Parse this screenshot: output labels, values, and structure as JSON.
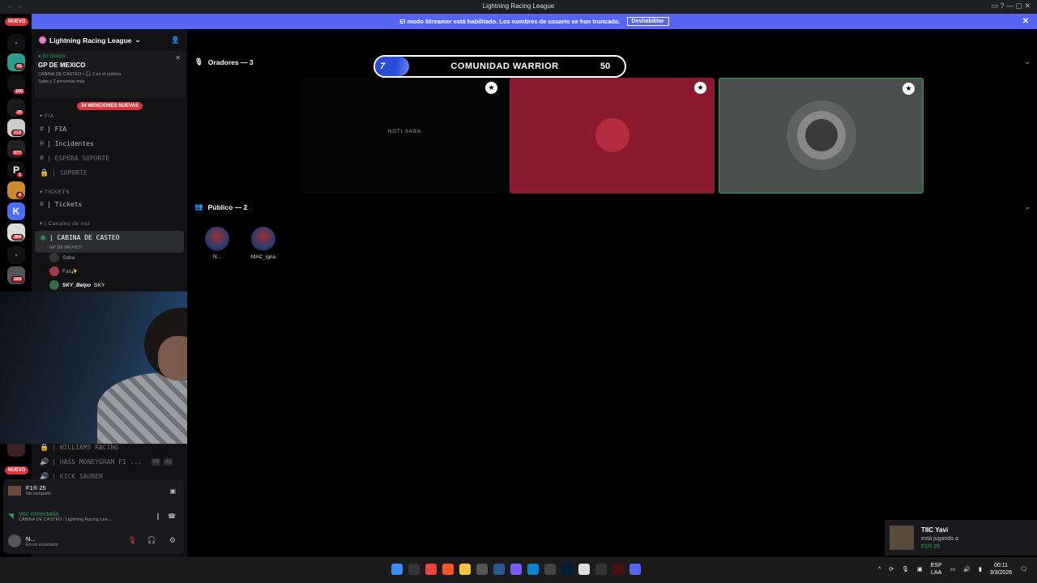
{
  "window": {
    "title": "Lightning Racing League",
    "nav": "←  →",
    "controls": "▭  ?  —  ▢  ✕"
  },
  "streamer_bar": {
    "message": "El modo Streamer está habilitado. Los nombres de usuario se han truncado.",
    "button": "Deshabilitar",
    "close": "✕"
  },
  "rail": {
    "nuevo_top": "NUEVO",
    "nuevo_bottom": "NUEVO",
    "badges": [
      "41",
      "160",
      "25",
      "113",
      "577",
      "1",
      "4",
      "384",
      "164"
    ]
  },
  "sidebar": {
    "guild_name": "Lightning Racing League",
    "guild_chevron": "⌄",
    "live": {
      "status": "En Directo",
      "event": "GP DE MEXICO",
      "info": "CABINA DE CASTEO • 🎧 2 en el público",
      "people": "Saba y 2 personas más",
      "close": "✕"
    },
    "mentions": "34 MENCIONES NUEVAS",
    "cat_fia": "FIA",
    "ch_fia": "| FIA",
    "ch_incidentes": "| Incidentes",
    "ch_espera": "| ESPERA SOPORTE",
    "ch_soporte": "| SOPORTE",
    "cat_tickets": "TICKETS",
    "ch_tickets": "| Tickets",
    "cat_voz": "| Canales de voz",
    "ch_cabina": "| CABINA DE CASTEO",
    "ch_cabina_sub": "GP DE MEXICO",
    "voice_users": [
      "Saba",
      "Fati✨",
      "SKY_Belpo"
    ],
    "sky_tag": "SKY",
    "ch_williams": "| WILLIAMS RACING",
    "ch_hass": "| HASS MONEYGRAM F1 ...",
    "ch_hass_counts": [
      "00",
      "03"
    ],
    "ch_kick": "| KICK SAUBER"
  },
  "user_panel": {
    "game": "F1® 25",
    "game_sub": "No compartir",
    "voice_status": "Voz conectada",
    "voice_channel": "CABINA DE CASTEO / Lightning Racing Lea...",
    "username": "N...",
    "user_status": "En un escenario"
  },
  "stage": {
    "speakers_label": "Oradores — 3",
    "audience_label": "Público — 2",
    "score": {
      "left": "7",
      "title": "COMUNIDAD WARRIOR",
      "right": "50"
    },
    "tile1_logo": "NOTI SABA",
    "audience": [
      "N...",
      "MAC_igna"
    ]
  },
  "toast": {
    "name": "TIIC Yavi",
    "action": "está jugando a",
    "game": "F1® 25"
  },
  "taskbar": {
    "lang1": "ESP",
    "lang2": "LAA",
    "time": "00:11",
    "date": "3/3/2026"
  },
  "colors": {
    "accent": "#5865f2",
    "danger": "#da373c",
    "online": "#23a55a",
    "tile_red": "#8b1a2e",
    "tile_gray": "#4a4e4c"
  }
}
